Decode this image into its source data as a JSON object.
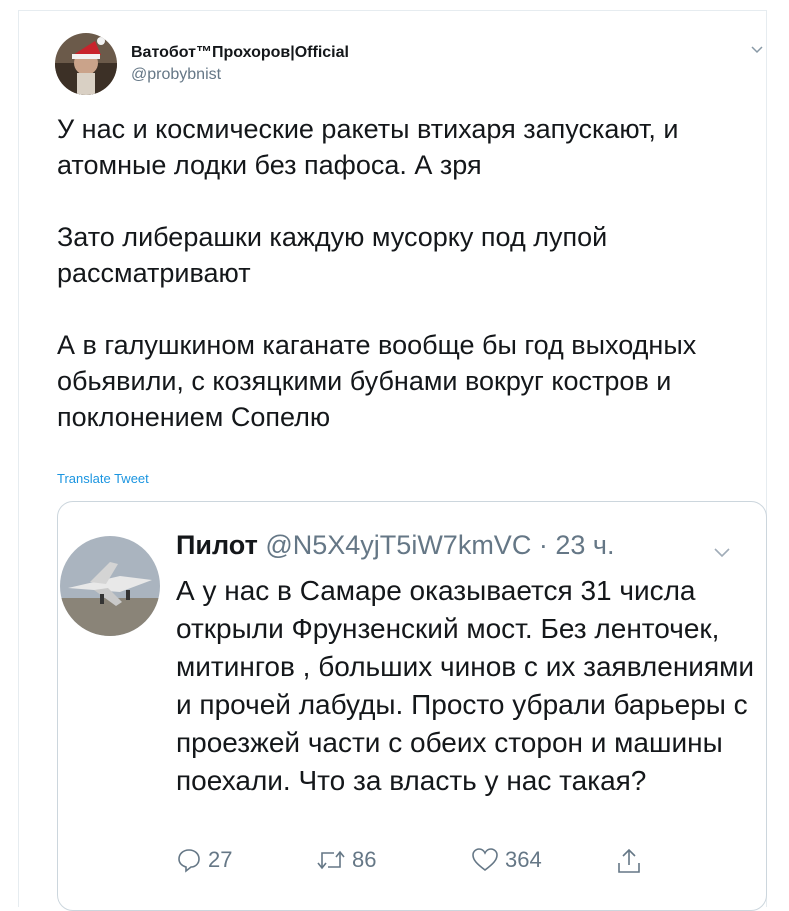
{
  "tweet": {
    "author": {
      "display_name": "Ватобот™Прохоров|Official",
      "handle": "@probybnist"
    },
    "paragraphs": [
      "У нас и космические ракеты втихаря запускают, и\nатомные лодки без пафоса. А зря",
      "Зато либерашки каждую мусорку под лупой\nрассматривают",
      "А в галушкином каганате вообще бы год выходных\nобьявили, с козяцкими бубнами вокруг костров и\nпоклонением Сопелю"
    ],
    "translate_label": "Translate Tweet"
  },
  "quoted": {
    "display_name": "Пилот",
    "handle": "@N5X4yjT5iW7kmVC",
    "separator": "·",
    "time": "23 ч.",
    "text": "А у нас в Самаре оказывается 31 числа открыли Фрунзенский мост. Без ленточек, митингов , больших чинов с их заявлениями и прочей лабуды. Просто убрали барьеры с проезжей части с обеих сторон и машины поехали. Что за власть у нас такая?",
    "actions": {
      "replies": "27",
      "retweets": "86",
      "likes": "364"
    },
    "icons": [
      "reply-icon",
      "retweet-icon",
      "like-icon",
      "share-icon"
    ]
  },
  "colors": {
    "text": "#14171a",
    "secondary": "#657786",
    "link": "#1b95e0",
    "border": "#ccd6dd"
  }
}
